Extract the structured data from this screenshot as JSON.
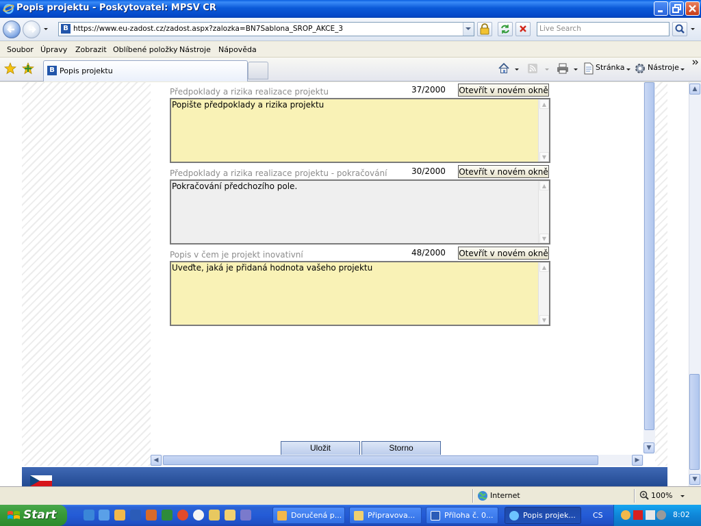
{
  "window": {
    "title": "Popis projektu - Poskytovatel: MPSV CR"
  },
  "address_bar": {
    "url": "https://www.eu-zadost.cz/zadost.aspx?zalozka=BN7Sablona_SROP_AKCE_3",
    "search_placeholder": "Live Search"
  },
  "menu": [
    "Soubor",
    "Úpravy",
    "Zobrazit",
    "Oblíbené položky",
    "Nástroje",
    "Nápověda"
  ],
  "tabs": {
    "active_label": "Popis projektu",
    "favicon_letter": "B"
  },
  "command_bar": {
    "page_label": "Stránka",
    "tools_label": "Nástroje"
  },
  "form": {
    "open_button_label": "Otevřít v novém okně",
    "fields": [
      {
        "label": "Předpoklady a rizika realizace projektu",
        "count": "37/2000",
        "value": "Popište předpoklady a rizika projektu",
        "editable": true
      },
      {
        "label": "Předpoklady a rizika realizace projektu - pokračování",
        "count": "30/2000",
        "value": "Pokračování předchozího pole.",
        "editable": false
      },
      {
        "label": "Popis v čem je projekt inovativní",
        "count": "48/2000",
        "value": "Uveďte, jaká je přidaná hodnota vašeho projektu",
        "editable": true
      }
    ],
    "save_label": "Uložit",
    "cancel_label": "Storno"
  },
  "status_bar": {
    "zone": "Internet",
    "zoom": "100%"
  },
  "taskbar": {
    "start_label": "Start",
    "tasks": [
      {
        "label": "Doručená p...",
        "icon": "outlook-icon"
      },
      {
        "label": "Připravova...",
        "icon": "folder-icon"
      },
      {
        "label": "Příloha č. 0...",
        "icon": "word-icon"
      },
      {
        "label": "Popis projek...",
        "icon": "ie-icon",
        "active": true
      }
    ],
    "language": "CS",
    "clock": "8:02"
  },
  "colors": {
    "field_editable_bg": "#f9f2b6",
    "field_readonly_bg": "#efefef",
    "title_bar": "#0b5ad8",
    "taskbar": "#245bd6"
  }
}
